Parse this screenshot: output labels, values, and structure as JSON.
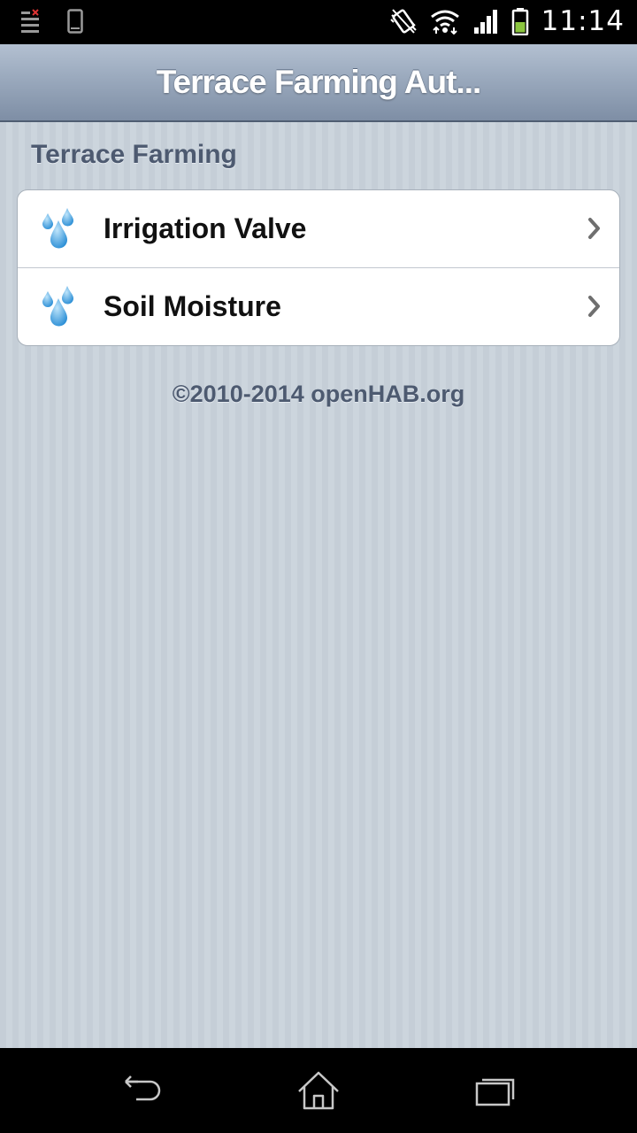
{
  "status_bar": {
    "time": "11:14",
    "icons": [
      "notification-list-icon",
      "phone-icon",
      "vibrate-icon",
      "wifi-icon",
      "signal-icon",
      "battery-icon"
    ]
  },
  "header": {
    "title": "Terrace Farming Aut..."
  },
  "group": {
    "title": "Terrace Farming"
  },
  "items": [
    {
      "label": "Irrigation Valve",
      "icon": "water-drops-icon"
    },
    {
      "label": "Soil Moisture",
      "icon": "water-drops-icon"
    }
  ],
  "footer": {
    "text": "©2010-2014 openHAB.org"
  },
  "nav": {
    "buttons": [
      "back-icon",
      "home-icon",
      "recent-apps-icon"
    ]
  },
  "colors": {
    "header_top": "#b3c0d1",
    "header_bottom": "#7e8ea5",
    "group_text": "#4d5a70",
    "drop_blue": "#4aa3df"
  }
}
